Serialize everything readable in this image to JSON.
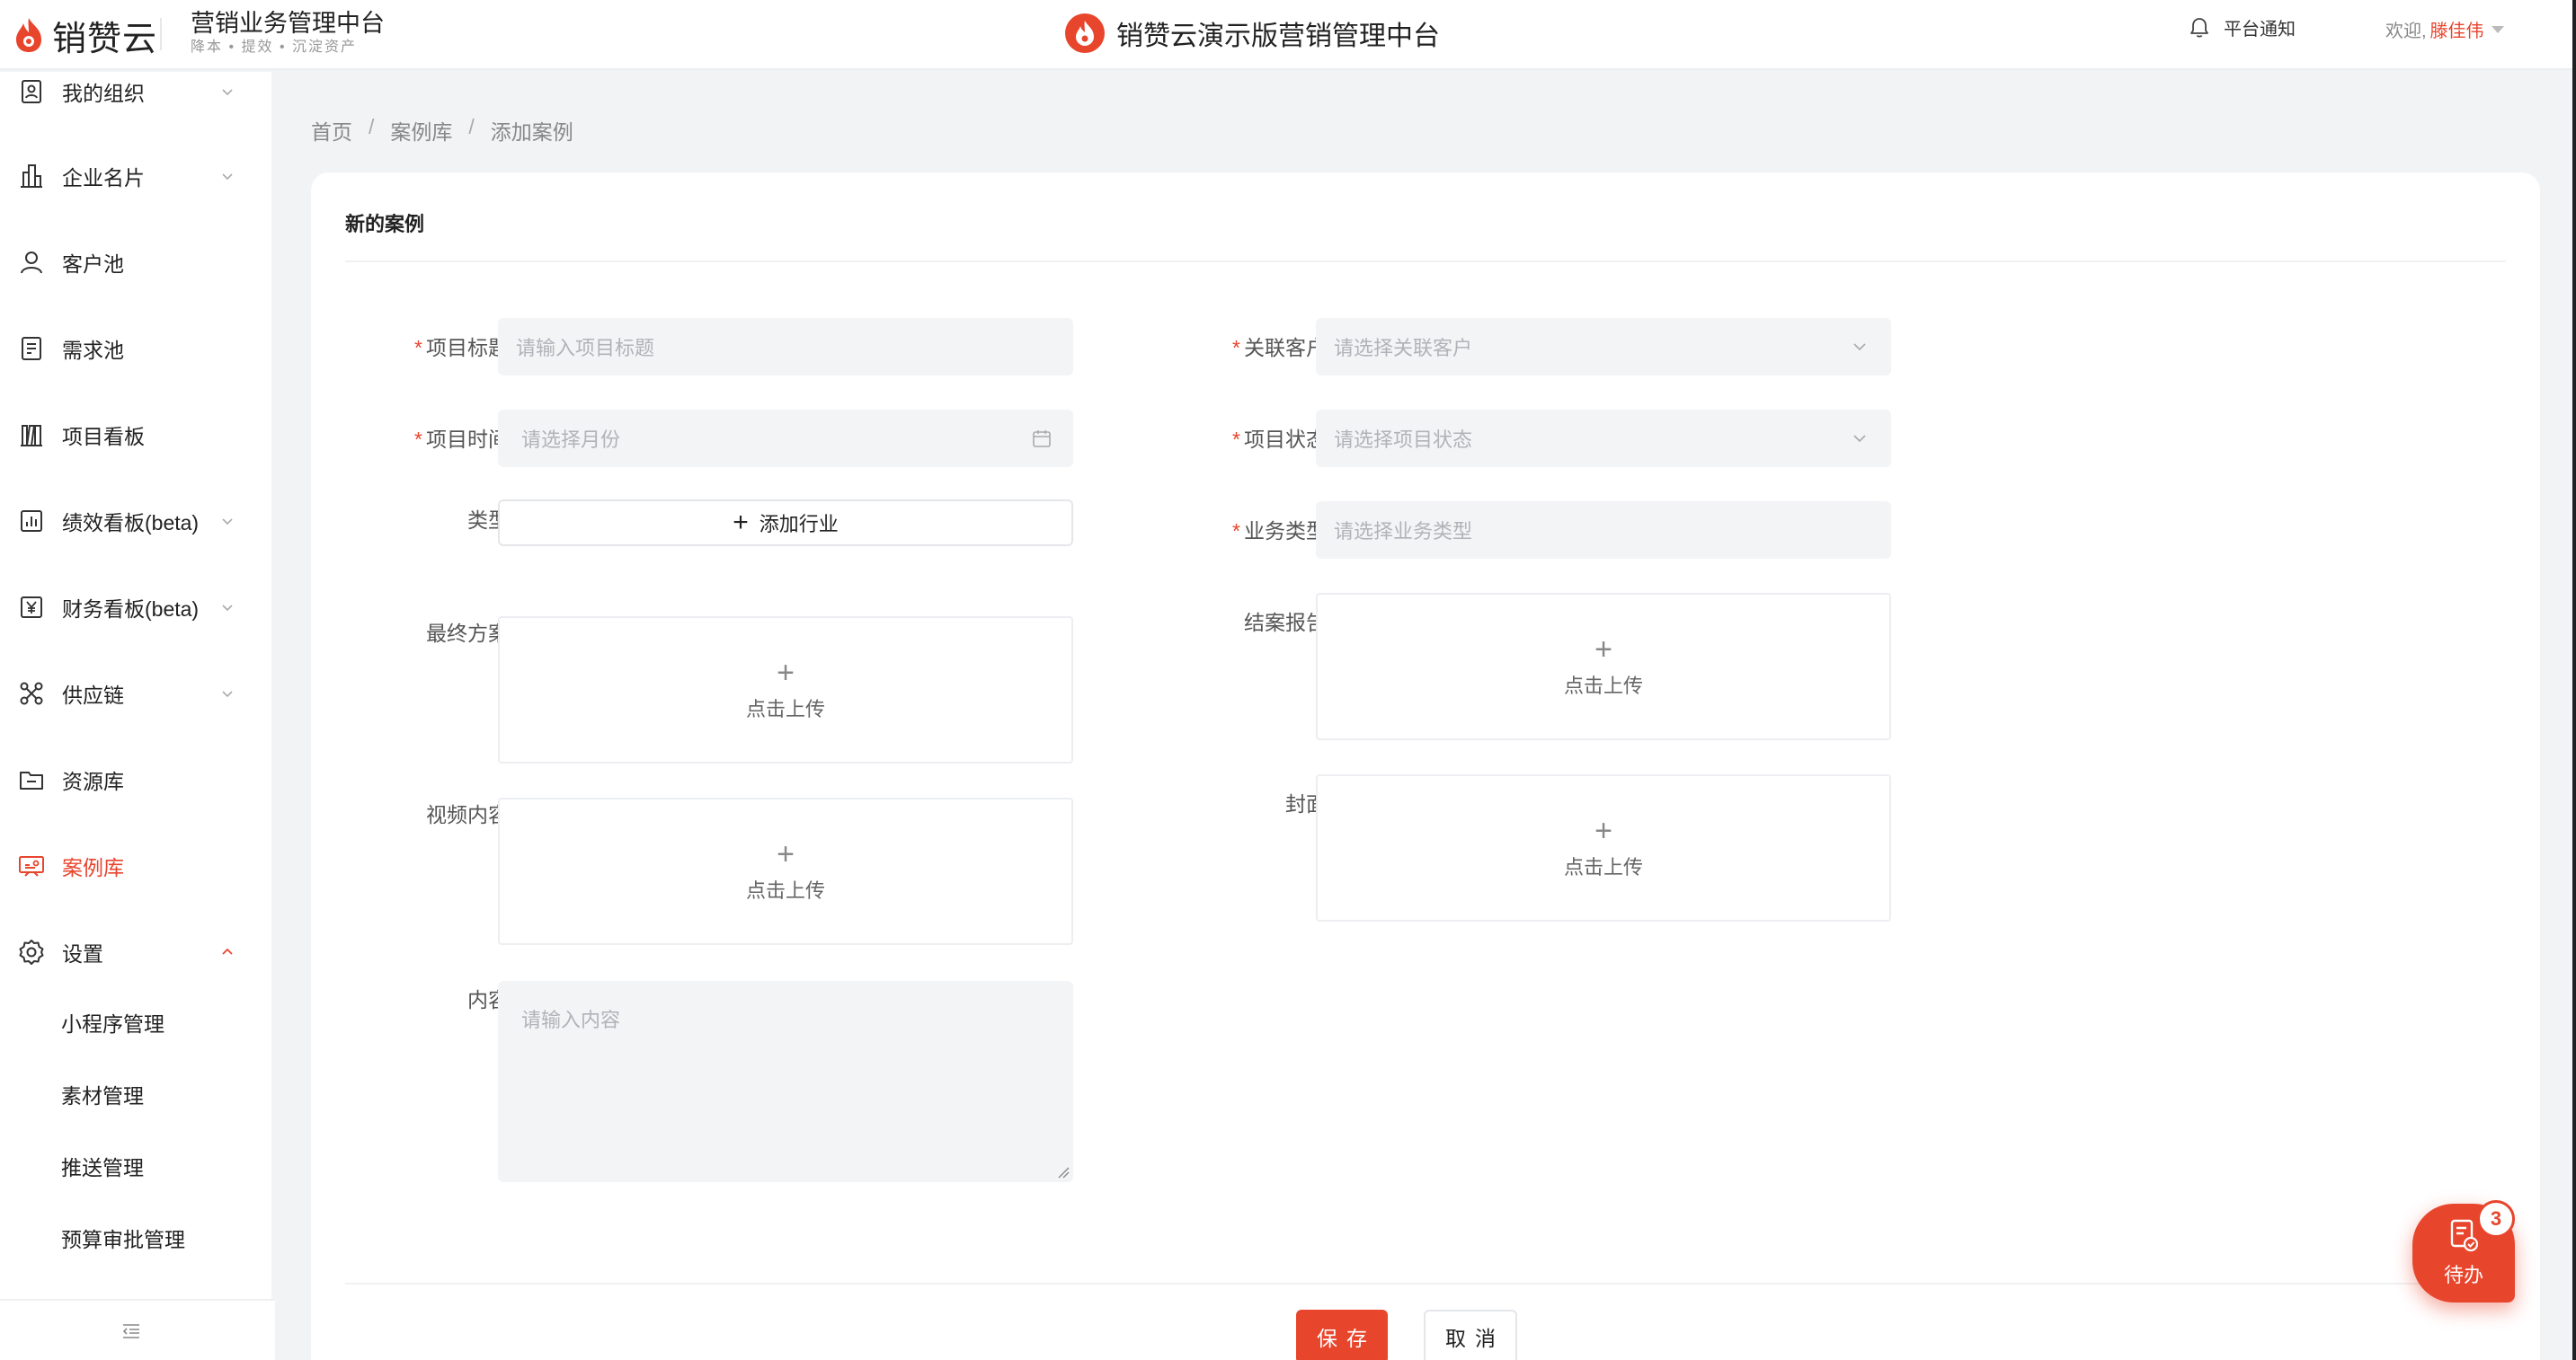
{
  "header": {
    "logo_text": "销赞云",
    "system_title": "营销业务管理中台",
    "slogan": "降本 • 提效 • 沉淀资产",
    "center_title": "销赞云演示版营销管理中台",
    "notify_label": "平台通知",
    "welcome_label": "欢迎,",
    "user_name": "滕佳伟"
  },
  "sidebar": {
    "items": [
      {
        "label": "我的组织",
        "icon": "org-icon"
      },
      {
        "label": "企业名片",
        "icon": "building-icon"
      },
      {
        "label": "客户池",
        "icon": "user-icon"
      },
      {
        "label": "需求池",
        "icon": "list-icon"
      },
      {
        "label": "项目看板",
        "icon": "board-icon"
      },
      {
        "label": "绩效看板(beta)",
        "icon": "bar-chart-icon"
      },
      {
        "label": "财务看板(beta)",
        "icon": "yen-icon"
      },
      {
        "label": "供应链",
        "icon": "network-icon"
      },
      {
        "label": "资源库",
        "icon": "folder-icon"
      },
      {
        "label": "案例库",
        "icon": "case-icon"
      },
      {
        "label": "设置",
        "icon": "gear-icon"
      }
    ],
    "sub_items": [
      "小程序管理",
      "素材管理",
      "推送管理",
      "预算审批管理"
    ]
  },
  "breadcrumb": [
    "首页",
    "案例库",
    "添加案例"
  ],
  "form": {
    "title": "新的案例",
    "project_title": {
      "label": "项目标题",
      "placeholder": "请输入项目标题"
    },
    "project_time": {
      "label": "项目时间",
      "placeholder": "请选择月份"
    },
    "type": {
      "label": "类型",
      "button": "添加行业"
    },
    "final_plan": {
      "label": "最终方案",
      "upload_text": "点击上传"
    },
    "video": {
      "label": "视频内容",
      "upload_text": "点击上传"
    },
    "content": {
      "label": "内容",
      "placeholder": "请输入内容"
    },
    "customer": {
      "label": "关联客户",
      "placeholder": "请选择关联客户"
    },
    "status": {
      "label": "项目状态",
      "placeholder": "请选择项目状态"
    },
    "business_type": {
      "label": "业务类型",
      "placeholder": "请选择业务类型"
    },
    "closing_report": {
      "label": "结案报告",
      "upload_text": "点击上传"
    },
    "cover": {
      "label": "封面",
      "upload_text": "点击上传"
    },
    "required_mark": "*"
  },
  "actions": {
    "save": "保存",
    "cancel": "取消"
  },
  "todo": {
    "label": "待办",
    "count": "3"
  },
  "colors": {
    "accent": "#e8452d",
    "bg": "#f2f3f5",
    "input_bg": "#f3f4f6"
  }
}
